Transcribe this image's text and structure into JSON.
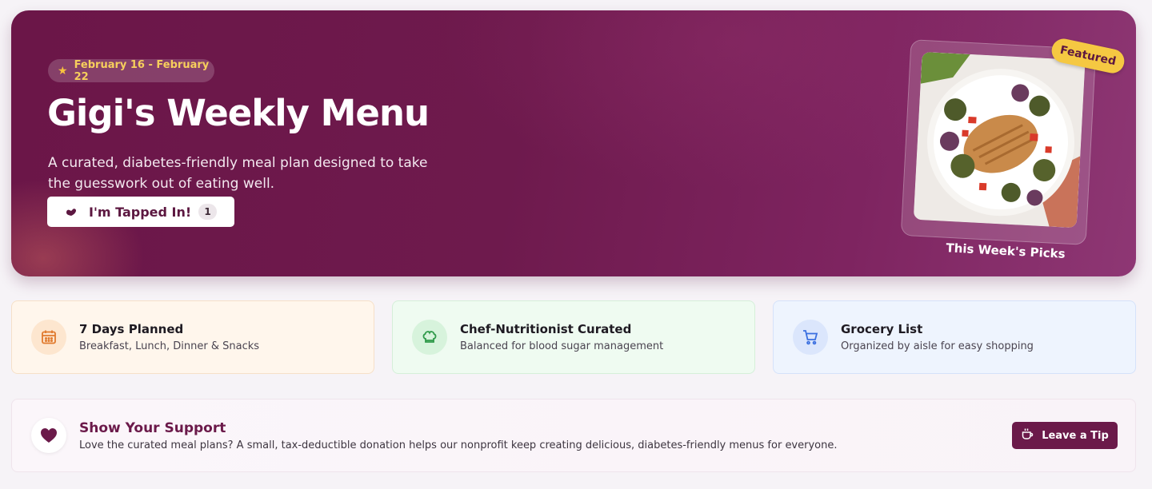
{
  "hero": {
    "date_range": "February 16 - February 22",
    "title": "Gigi's Weekly Menu",
    "subtitle": "A curated, diabetes-friendly meal plan designed to take the guesswork out of eating well.",
    "tap_button_label": "I'm Tapped In!",
    "tap_count": "1",
    "featured_badge": "Featured",
    "featured_caption": "This Week's Picks"
  },
  "features": [
    {
      "title": "7 Days Planned",
      "subtitle": "Breakfast, Lunch, Dinner & Snacks",
      "icon": "calendar-icon",
      "color": "#e07a2e"
    },
    {
      "title": "Chef-Nutritionist Curated",
      "subtitle": "Balanced for blood sugar management",
      "icon": "chef-hat-icon",
      "color": "#2f9a4a"
    },
    {
      "title": "Grocery List",
      "subtitle": "Organized by aisle for easy shopping",
      "icon": "cart-icon",
      "color": "#3a6fe0"
    }
  ],
  "support": {
    "title": "Show Your Support",
    "text": "Love the curated meal plans? A small, tax-deductible donation helps our nonprofit keep creating delicious, diabetes-friendly menus for everyone.",
    "button_label": "Leave a Tip"
  },
  "colors": {
    "brand": "#6b1a4a",
    "accent_yellow": "#f5c842"
  }
}
